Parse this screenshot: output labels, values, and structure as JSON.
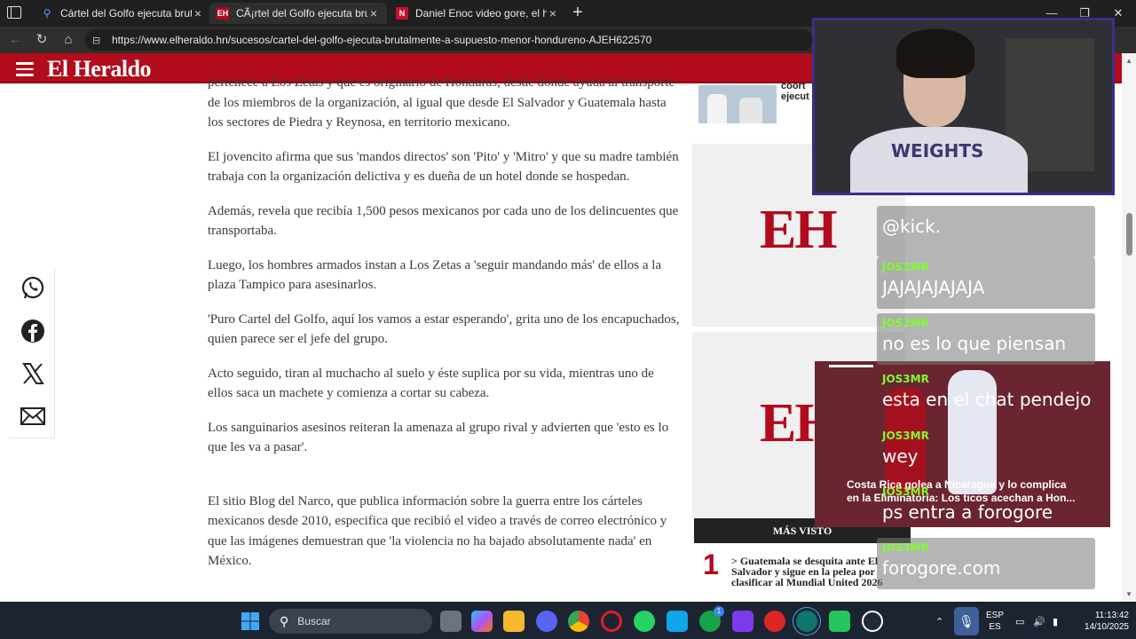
{
  "browser": {
    "tabs": [
      {
        "label": "Cártel del Golfo ejecuta brutalmente",
        "favicon": "search-icon",
        "active": false
      },
      {
        "label": "CÃ¡rtel del Golfo ejecuta brutalmente",
        "favicon": "EH",
        "active": true
      },
      {
        "label": "Daniel Enoc video gore, el hondureño",
        "favicon": "N",
        "active": false
      }
    ],
    "new_tab": "+",
    "url": "https://www.elheraldo.hn/sucesos/cartel-del-golfo-ejecuta-brutalmente-a-supuesto-menor-hondureno-AJEH622570",
    "window_controls": {
      "minimize": "—",
      "maximize": "❐",
      "close": "✕"
    }
  },
  "site": {
    "brand": "El Heraldo",
    "brand_color": "#b10b1c"
  },
  "article": {
    "paragraphs": [
      "pertenece a Los Zetas y que es originario de Honduras, desde donde ayuda al transporte de los miembros de la organización, al igual que desde El Salvador y Guatemala hasta los sectores de Piedra y Reynosa, en territorio mexicano.",
      "El jovencito afirma que sus 'mandos directos' son 'Pito' y 'Mitro' y que su madre también trabaja con la organización delictiva y es dueña de un hotel donde se hospedan.",
      "Además, revela que recibía 1,500 pesos mexicanos por cada uno de los delincuentes que transportaba.",
      "Luego, los hombres armados instan a Los Zetas a 'seguir mandando más' de ellos a la plaza Tampico para asesinarlos.",
      "'Puro Cartel del Golfo, aquí los vamos a estar esperando', grita uno de los encapuchados, quien parece ser el jefe del grupo.",
      "Acto seguido, tiran al muchacho al suelo y éste suplica por su vida, mientras uno de ellos saca un machete y comienza a cortar su cabeza.",
      "Los sanguinarios asesinos reiteran la amenaza al grupo rival y advierten que 'esto es lo que les va a pasar'.",
      "El sitio Blog del Narco, que publica información sobre la guerra entre los cárteles mexicanos desde 2010, especifica que recibió el video a través de correo electrónico y que las imágenes demuestran que 'la violencia no ha bajado absolutamente nada' en México."
    ]
  },
  "sidebar": {
    "thumb_caption": "coort ejecut",
    "ad_logo": "EH",
    "mas_visto": "MÁS VISTO",
    "rank_number": "1",
    "rank_text": "> Guatemala se desquita ante El Salvador y sigue en la pelea por clasificar al Mundial United 2026"
  },
  "share": [
    "whatsapp-icon",
    "facebook-icon",
    "x-icon",
    "mail-icon"
  ],
  "webcam": {
    "shirt_text": "WEIGHTS"
  },
  "chat": {
    "messages": [
      {
        "user": "JOS3MR",
        "text": "@kick."
      },
      {
        "user": "JOS3MR",
        "text": "JAJAJAJAJAJA"
      },
      {
        "user": "JOS3MR",
        "text": "no es lo que piensan"
      },
      {
        "user": "JOS3MR",
        "text": "esta en el chat pendejo"
      },
      {
        "user": "JOS3MR",
        "text": "wey"
      },
      {
        "user": "JOS3MR",
        "text": "ps entra a forogore"
      },
      {
        "user": "JOS3MR",
        "text": "forogore.com"
      }
    ]
  },
  "video": {
    "title": "Costa Rica golea a Nicaragua y lo complica en la Eliminatoria: Los ticos acechan a Hon..."
  },
  "taskbar": {
    "search_placeholder": "Buscar",
    "lang_line1": "ESP",
    "lang_line2": "ES",
    "time": "11:13:42",
    "date": "14/10/2025",
    "badge": "1"
  }
}
